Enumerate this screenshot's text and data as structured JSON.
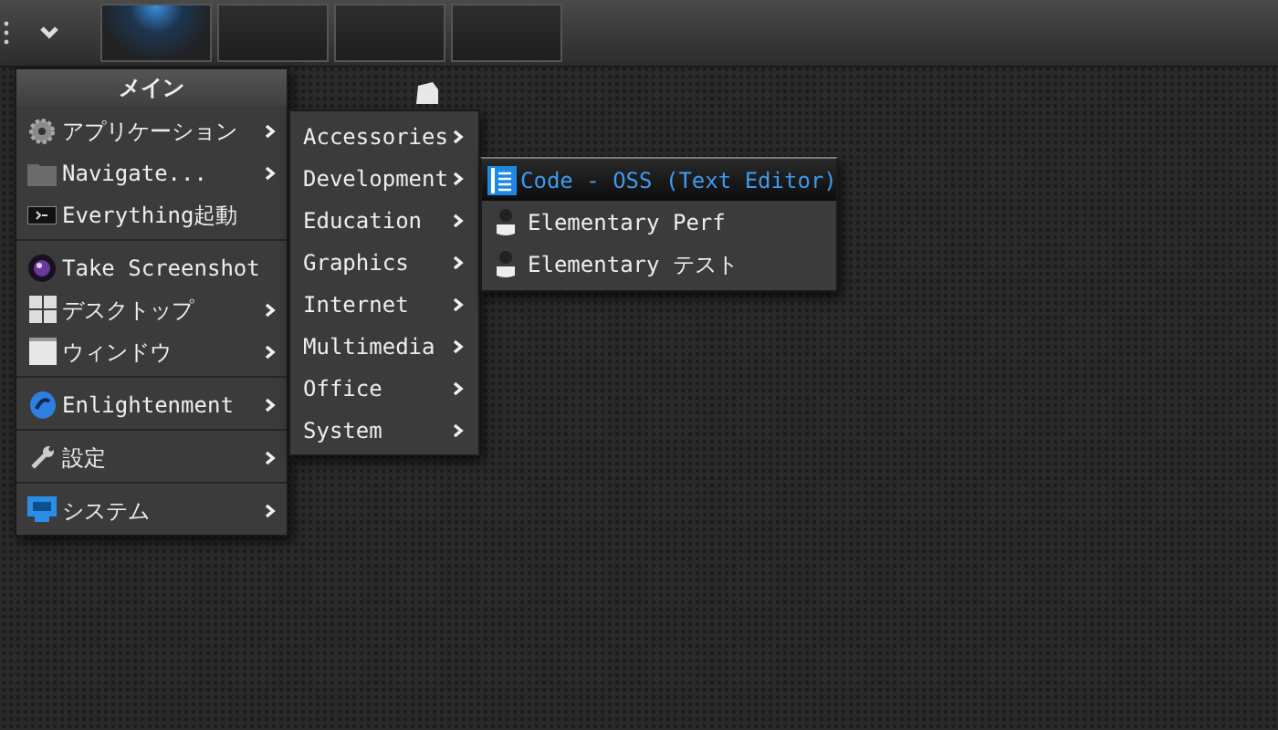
{
  "pager": {
    "desks": [
      {
        "selected": true
      },
      {
        "selected": false
      },
      {
        "selected": false
      },
      {
        "selected": false
      }
    ]
  },
  "main_menu": {
    "title": "メイン",
    "sections": [
      [
        {
          "label": "アプリケーション",
          "has_submenu": true
        },
        {
          "label": "Navigate...",
          "has_submenu": true
        },
        {
          "label": "Everything起動",
          "has_submenu": false
        }
      ],
      [
        {
          "label": "Take Screenshot",
          "has_submenu": false
        },
        {
          "label": "デスクトップ",
          "has_submenu": true
        },
        {
          "label": "ウィンドウ",
          "has_submenu": true
        }
      ],
      [
        {
          "label": "Enlightenment",
          "has_submenu": true
        }
      ],
      [
        {
          "label": "設定",
          "has_submenu": true
        }
      ],
      [
        {
          "label": "システム",
          "has_submenu": true
        }
      ]
    ]
  },
  "applications_menu": {
    "items": [
      {
        "label": "Accessories",
        "has_submenu": true
      },
      {
        "label": "Development",
        "has_submenu": true
      },
      {
        "label": "Education",
        "has_submenu": true
      },
      {
        "label": "Graphics",
        "has_submenu": true
      },
      {
        "label": "Internet",
        "has_submenu": true
      },
      {
        "label": "Multimedia",
        "has_submenu": true
      },
      {
        "label": "Office",
        "has_submenu": true
      },
      {
        "label": "System",
        "has_submenu": true
      }
    ]
  },
  "development_menu": {
    "items": [
      {
        "label": "Code - OSS (Text Editor)",
        "selected": true
      },
      {
        "label": "Elementary Perf",
        "selected": false
      },
      {
        "label": "Elementary テスト",
        "selected": false
      }
    ]
  }
}
